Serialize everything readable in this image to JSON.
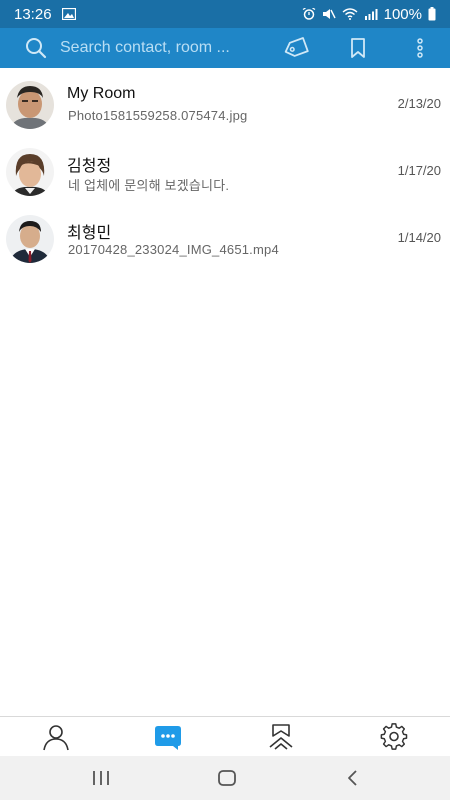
{
  "status_bar": {
    "time": "13:26",
    "battery": "100%",
    "icons": [
      "image-icon",
      "alarm-icon",
      "mute-icon",
      "wifi-icon",
      "signal-icon",
      "battery-icon"
    ]
  },
  "toolbar": {
    "search_placeholder": "Search contact, room ...",
    "icons": [
      "search-icon",
      "tag-icon",
      "bookmark-icon",
      "more-icon"
    ]
  },
  "chats": [
    {
      "name": "My Room",
      "preview": "Photo1581559258.075474.jpg",
      "date": "2/13/20",
      "avatar": "man-avatar"
    },
    {
      "name": "김청정",
      "preview": "네 업체에 문의해 보겠습니다.",
      "date": "1/17/20",
      "avatar": "woman-avatar"
    },
    {
      "name": "최형민",
      "preview": "20170428_233024_IMG_4651.mp4",
      "date": "1/14/20",
      "avatar": "man-suit-avatar"
    }
  ],
  "bottom_nav": {
    "tabs": [
      "contacts-tab",
      "chats-tab",
      "bookmarks-tab",
      "settings-tab"
    ],
    "active": "chats-tab",
    "accent_color": "#1f9be8"
  },
  "colors": {
    "status_bar": "#1a6fa6",
    "app_bar": "#1f86c7"
  }
}
